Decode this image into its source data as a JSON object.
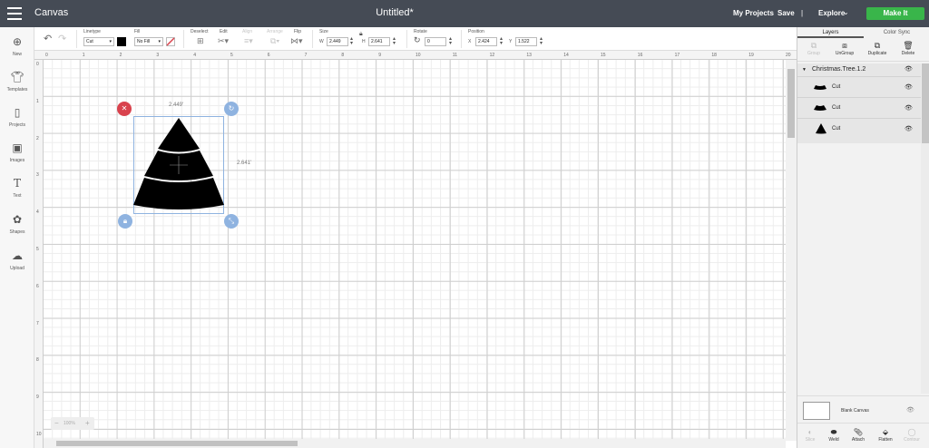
{
  "topbar": {
    "app_title": "Canvas",
    "doc_title": "Untitled*",
    "my_projects": "My Projects",
    "save": "Save",
    "separator": "|",
    "explore": "Explore",
    "make_it": "Make It"
  },
  "toolbar": {
    "linetype_label": "Linetype",
    "linetype_value": "Cut",
    "fill_label": "Fill",
    "fill_value": "No Fill",
    "deselect_label": "Deselect",
    "edit_label": "Edit",
    "align_label": "Align",
    "arrange_label": "Arrange",
    "flip_label": "Flip",
    "size_label": "Size",
    "w_label": "W",
    "w_value": "2.449",
    "h_label": "H",
    "h_value": "2.641",
    "rotate_label": "Rotate",
    "rotate_value": "0",
    "position_label": "Position",
    "x_label": "X",
    "x_value": "2.424",
    "y_label": "Y",
    "y_value": "1.522"
  },
  "sidebar": {
    "items": [
      {
        "label": "New",
        "icon": "plus-circle-icon"
      },
      {
        "label": "Templates",
        "icon": "shirt-icon"
      },
      {
        "label": "Projects",
        "icon": "book-icon"
      },
      {
        "label": "Images",
        "icon": "image-icon"
      },
      {
        "label": "Text",
        "icon": "text-icon"
      },
      {
        "label": "Shapes",
        "icon": "shapes-icon"
      },
      {
        "label": "Upload",
        "icon": "cloud-upload-icon"
      }
    ]
  },
  "canvas": {
    "ruler_top": [
      "0",
      "1",
      "2",
      "3",
      "4",
      "5",
      "6",
      "7",
      "8",
      "9",
      "10",
      "11",
      "12",
      "13",
      "14",
      "15",
      "16",
      "17",
      "18",
      "19",
      "20"
    ],
    "ruler_left": [
      "1",
      "2",
      "3",
      "4",
      "5",
      "6",
      "7",
      "8",
      "9",
      "10"
    ],
    "ruler_left_zero": "0",
    "width_label": "2.449'",
    "height_label": "2.641'",
    "zoom": "100%",
    "zoom_minus": "−",
    "zoom_plus": "+"
  },
  "layers_panel": {
    "tab_layers": "Layers",
    "tab_color_sync": "Color Sync",
    "actions": [
      "Group",
      "UnGroup",
      "Duplicate",
      "Delete"
    ],
    "group_name": "Christmas.Tree.1.2",
    "layers": [
      {
        "label": "Cut"
      },
      {
        "label": "Cut"
      },
      {
        "label": "Cut"
      }
    ],
    "blank_canvas": "Blank Canvas",
    "bottom_actions": [
      "Slice",
      "Weld",
      "Attach",
      "Flatten",
      "Contour"
    ]
  },
  "colors": {
    "topbar": "#454b55",
    "make_it": "#39b54a",
    "close_handle": "#d9424d",
    "handle": "#8fb3e0"
  }
}
